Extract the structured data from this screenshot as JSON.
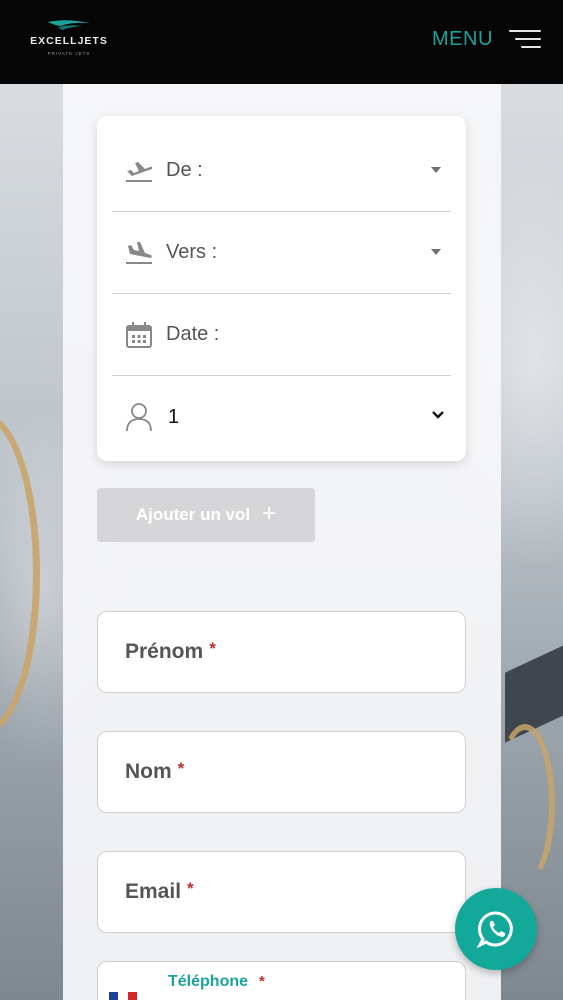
{
  "header": {
    "brand_name": "EXCELLJETS",
    "brand_tagline": "PRIVATE JETS",
    "menu_label": "MENU"
  },
  "search": {
    "from_label": "De :",
    "to_label": "Vers :",
    "date_label": "Date :",
    "passengers_value": "1",
    "add_flight_label": "Ajouter un vol",
    "add_flight_plus": "+"
  },
  "form": {
    "first_name_label": "Prénom",
    "last_name_label": "Nom",
    "email_label": "Email",
    "phone_label": "Téléphone",
    "required_mark": "*"
  },
  "colors": {
    "accent": "#1ba39c",
    "whatsapp": "#12a89a",
    "required": "#b8322d",
    "header_bg": "#050505"
  },
  "icons": {
    "takeoff": "takeoff-icon",
    "landing": "landing-icon",
    "calendar": "calendar-icon",
    "passenger": "user-icon",
    "menu": "hamburger-icon",
    "chat": "whatsapp-icon",
    "flag": "france-flag-icon"
  }
}
